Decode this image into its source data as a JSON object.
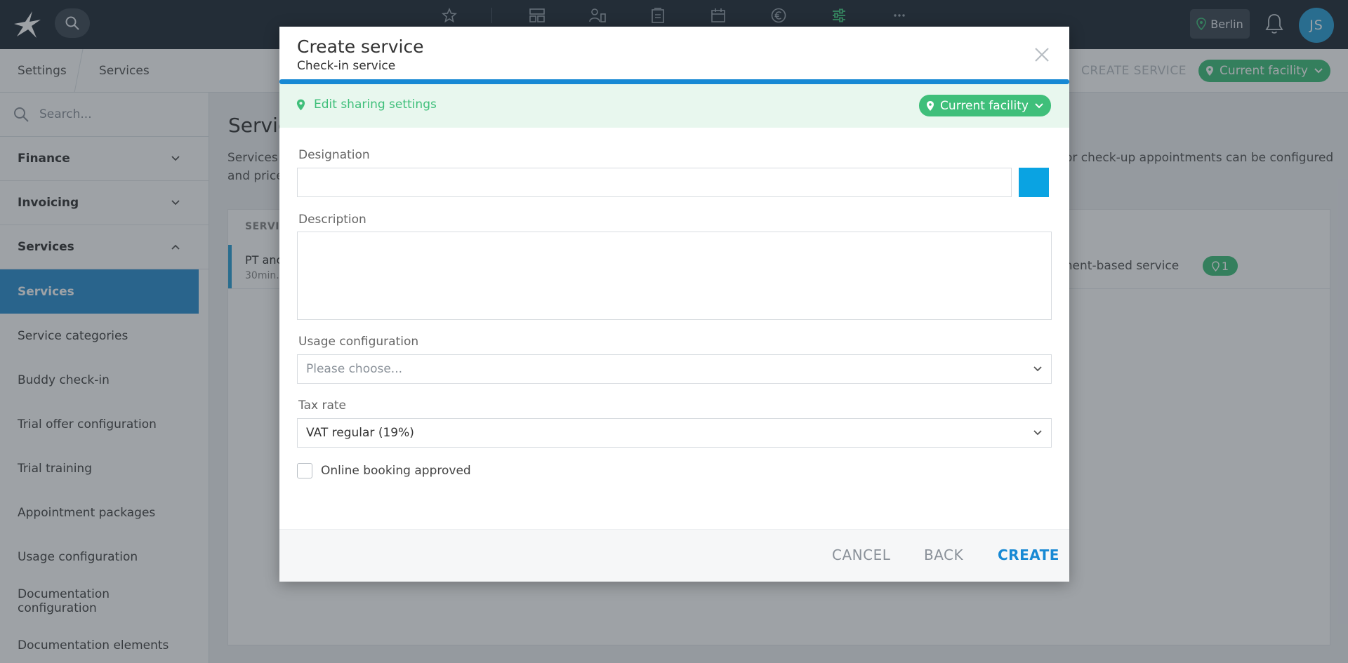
{
  "topbar": {
    "location": "Berlin",
    "avatar_initials": "JS"
  },
  "breadcrumb": {
    "first": "Settings",
    "second": "Services"
  },
  "header_actions": {
    "create_service": "CREATE SERVICE",
    "facility": "Current facility"
  },
  "sidebar": {
    "search_placeholder": "Search...",
    "items": [
      {
        "label": "Finance"
      },
      {
        "label": "Invoicing"
      },
      {
        "label": "Services"
      },
      {
        "label": "Services"
      },
      {
        "label": "Service categories"
      },
      {
        "label": "Buddy check-in"
      },
      {
        "label": "Trial offer configuration"
      },
      {
        "label": "Trial training"
      },
      {
        "label": "Appointment packages"
      },
      {
        "label": "Usage configuration"
      },
      {
        "label": "Documentation configuration"
      },
      {
        "label": "Documentation elements"
      }
    ]
  },
  "main": {
    "title": "Servic",
    "desc_left_line1": "Services c",
    "desc_left_line2": "and price",
    "desc_right": "or check-up appointments can be configured",
    "column_header": "SERVIC",
    "row": {
      "name": "PT anc",
      "sub": "30min.",
      "type": "ment-based service",
      "badge_count": "1"
    }
  },
  "modal": {
    "title": "Create service",
    "subtitle": "Check-in service",
    "sharing_link": "Edit sharing settings",
    "sharing_facility": "Current facility",
    "designation_label": "Designation",
    "designation_value": "",
    "swatch_color": "#0aa3e2",
    "description_label": "Description",
    "description_value": "",
    "usage_label": "Usage configuration",
    "usage_placeholder": "Please choose...",
    "tax_label": "Tax rate",
    "tax_value": "VAT regular (19%)",
    "online_booking_label": "Online booking approved",
    "cancel": "CANCEL",
    "back": "BACK",
    "create": "CREATE"
  }
}
